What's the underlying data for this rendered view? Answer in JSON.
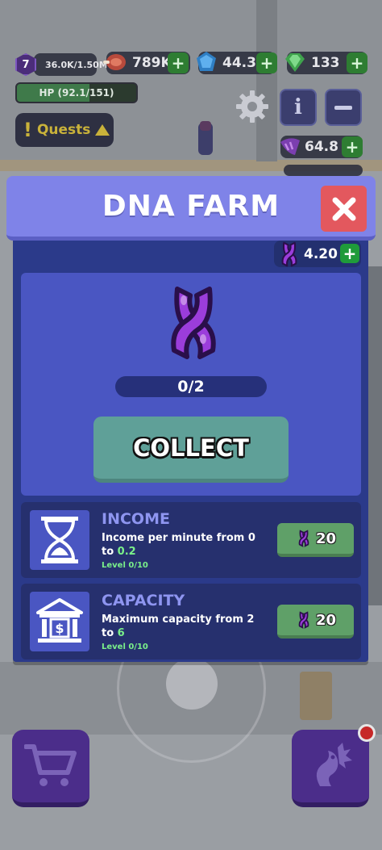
{
  "hud": {
    "level": "7",
    "xp": "36.0K/1.50M",
    "hp": "HP (92.1/151)",
    "hp_fraction": 0.61,
    "meat": "789K",
    "blue_gem": "44.3",
    "green_gem": "133",
    "purple_resource": "64.8",
    "quests_label": "Quests",
    "info_label": "i"
  },
  "modal": {
    "title": "DNA FARM",
    "dna_balance": "4.20",
    "progress_text": "0/2",
    "progress_fraction": 0,
    "collect_label": "COLLECT",
    "upgrades": [
      {
        "title": "INCOME",
        "desc_prefix": "Income per minute from 0 to ",
        "desc_value": "0.2",
        "level": "Level 0/10",
        "cost": "20"
      },
      {
        "title": "CAPACITY",
        "desc_prefix": "Maximum capacity from 2 to ",
        "desc_value": "6",
        "level": "Level 0/10",
        "cost": "20"
      }
    ]
  },
  "icons": {
    "close": "close-icon",
    "dna": "dna-icon",
    "hourglass": "hourglass-icon",
    "bank": "bank-icon",
    "cart": "cart-icon",
    "dragon": "dragon-icon",
    "gear": "gear-icon"
  },
  "colors": {
    "header": "#7f83e8",
    "panel": "#2b3a8a",
    "card": "#4a56c2",
    "close": "#e3585e",
    "collect": "#5fa098",
    "upgrade_button": "#5fa068",
    "dna_purple": "#9b3ddb",
    "highlight_green": "#7af08a"
  }
}
